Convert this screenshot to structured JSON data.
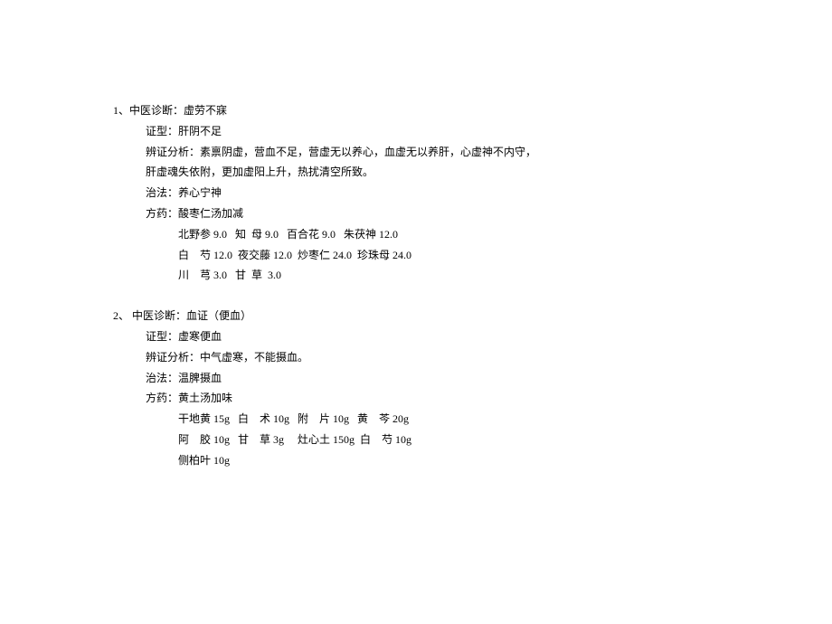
{
  "cases": [
    {
      "num": "1、",
      "diag_label": "中医诊断：",
      "diag_value": "虚劳不寐",
      "pattern_label": "证型：",
      "pattern_value": "肝阴不足",
      "analysis_label": "辨证分析：",
      "analysis_value": "素禀阴虚，营血不足，营虚无以养心，血虚无以养肝，心虚神不内守，",
      "analysis_cont": "肝虚魂失依附，更加虚阳上升，热扰清空所致。",
      "method_label": "治法：",
      "method_value": "养心宁神",
      "rx_label": "方药：",
      "rx_value": "酸枣仁汤加减",
      "herbs": [
        "北野参 9.0   知  母 9.0   百合花 9.0   朱茯神 12.0",
        "白    芍 12.0  夜交藤 12.0  炒枣仁 24.0  珍珠母 24.0",
        "川    芎 3.0   甘  草  3.0"
      ]
    },
    {
      "num": "2、",
      "diag_label": " 中医诊断：",
      "diag_value": "血证（便血）",
      "pattern_label": "证型：",
      "pattern_value": "虚寒便血",
      "analysis_label": "辨证分析：",
      "analysis_value": "中气虚寒，不能摄血。",
      "analysis_cont": "",
      "method_label": "治法：",
      "method_value": "温脾摄血",
      "rx_label": "方药：",
      "rx_value": "黄土汤加味",
      "herbs": [
        "干地黄 15g   白    术 10g   附    片 10g   黄    芩 20g",
        "阿    胶 10g   甘    草 3g     灶心土 150g  白    芍 10g",
        "侧柏叶 10g"
      ]
    }
  ]
}
